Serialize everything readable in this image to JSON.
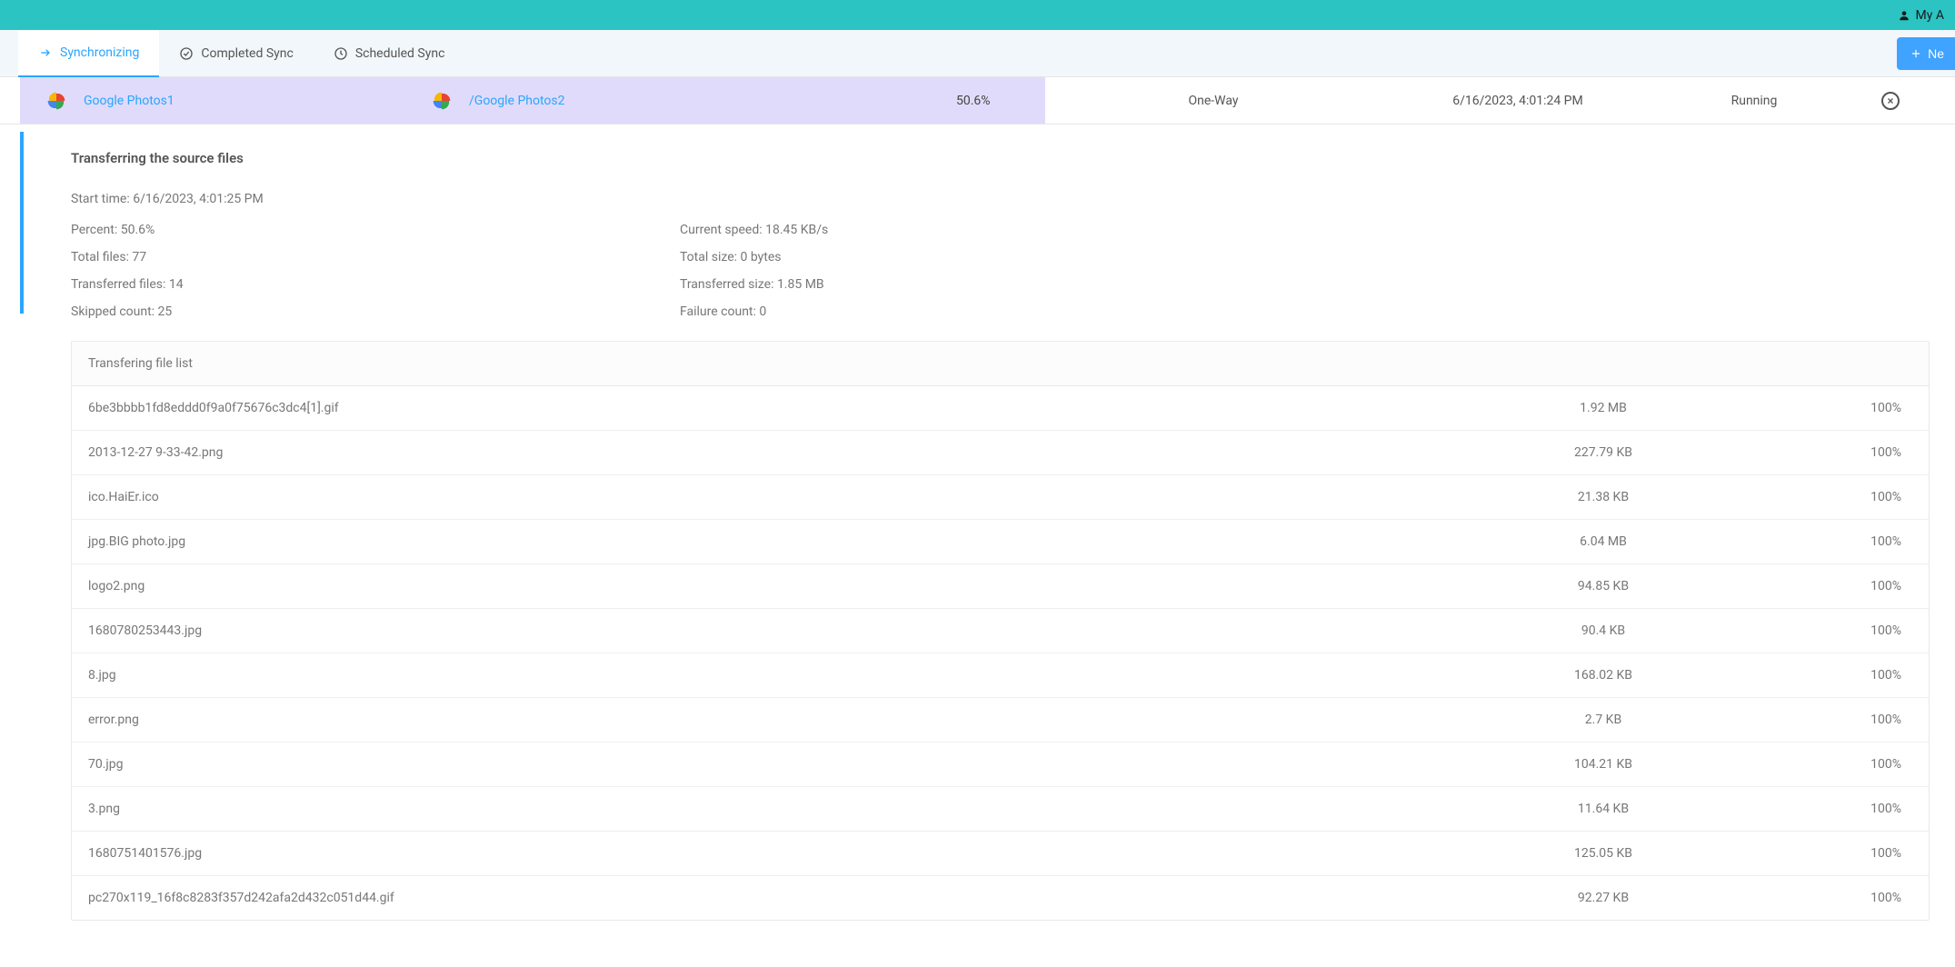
{
  "header": {
    "account_prefix": "My A"
  },
  "tabs": {
    "synchronizing": "Synchronizing",
    "completed": "Completed Sync",
    "scheduled": "Scheduled Sync",
    "new_button": "Ne"
  },
  "task": {
    "source_label": "Google Photos1",
    "dest_label": "/Google Photos2",
    "percent": "50.6%",
    "direction": "One-Way",
    "datetime": "6/16/2023, 4:01:24 PM",
    "status": "Running"
  },
  "details": {
    "heading": "Transferring the source files",
    "start_time_label": "Start time",
    "start_time": "6/16/2023, 4:01:25 PM",
    "percent_label": "Percent",
    "percent": "50.6%",
    "total_files_label": "Total files",
    "total_files": "77",
    "transferred_files_label": "Transferred files",
    "transferred_files": "14",
    "skipped_count_label": "Skipped count",
    "skipped_count": "25",
    "current_speed_label": "Current speed",
    "current_speed": "18.45 KB/s",
    "total_size_label": "Total size",
    "total_size": "0 bytes",
    "transferred_size_label": "Transferred size",
    "transferred_size": "1.85 MB",
    "failure_count_label": "Failure count",
    "failure_count": "0"
  },
  "file_list": {
    "header": "Transfering file list",
    "rows": [
      {
        "name": "6be3bbbb1fd8eddd0f9a0f75676c3dc4[1].gif",
        "size": "1.92 MB",
        "progress": "100%"
      },
      {
        "name": "2013-12-27 9-33-42.png",
        "size": "227.79 KB",
        "progress": "100%"
      },
      {
        "name": "ico.HaiEr.ico",
        "size": "21.38 KB",
        "progress": "100%"
      },
      {
        "name": "jpg.BIG photo.jpg",
        "size": "6.04 MB",
        "progress": "100%"
      },
      {
        "name": "logo2.png",
        "size": "94.85 KB",
        "progress": "100%"
      },
      {
        "name": "1680780253443.jpg",
        "size": "90.4 KB",
        "progress": "100%"
      },
      {
        "name": "8.jpg",
        "size": "168.02 KB",
        "progress": "100%"
      },
      {
        "name": "error.png",
        "size": "2.7 KB",
        "progress": "100%"
      },
      {
        "name": "70.jpg",
        "size": "104.21 KB",
        "progress": "100%"
      },
      {
        "name": "3.png",
        "size": "11.64 KB",
        "progress": "100%"
      },
      {
        "name": "1680751401576.jpg",
        "size": "125.05 KB",
        "progress": "100%"
      },
      {
        "name": "pc270x119_16f8c8283f357d242afa2d432c051d44.gif",
        "size": "92.27 KB",
        "progress": "100%"
      }
    ]
  }
}
